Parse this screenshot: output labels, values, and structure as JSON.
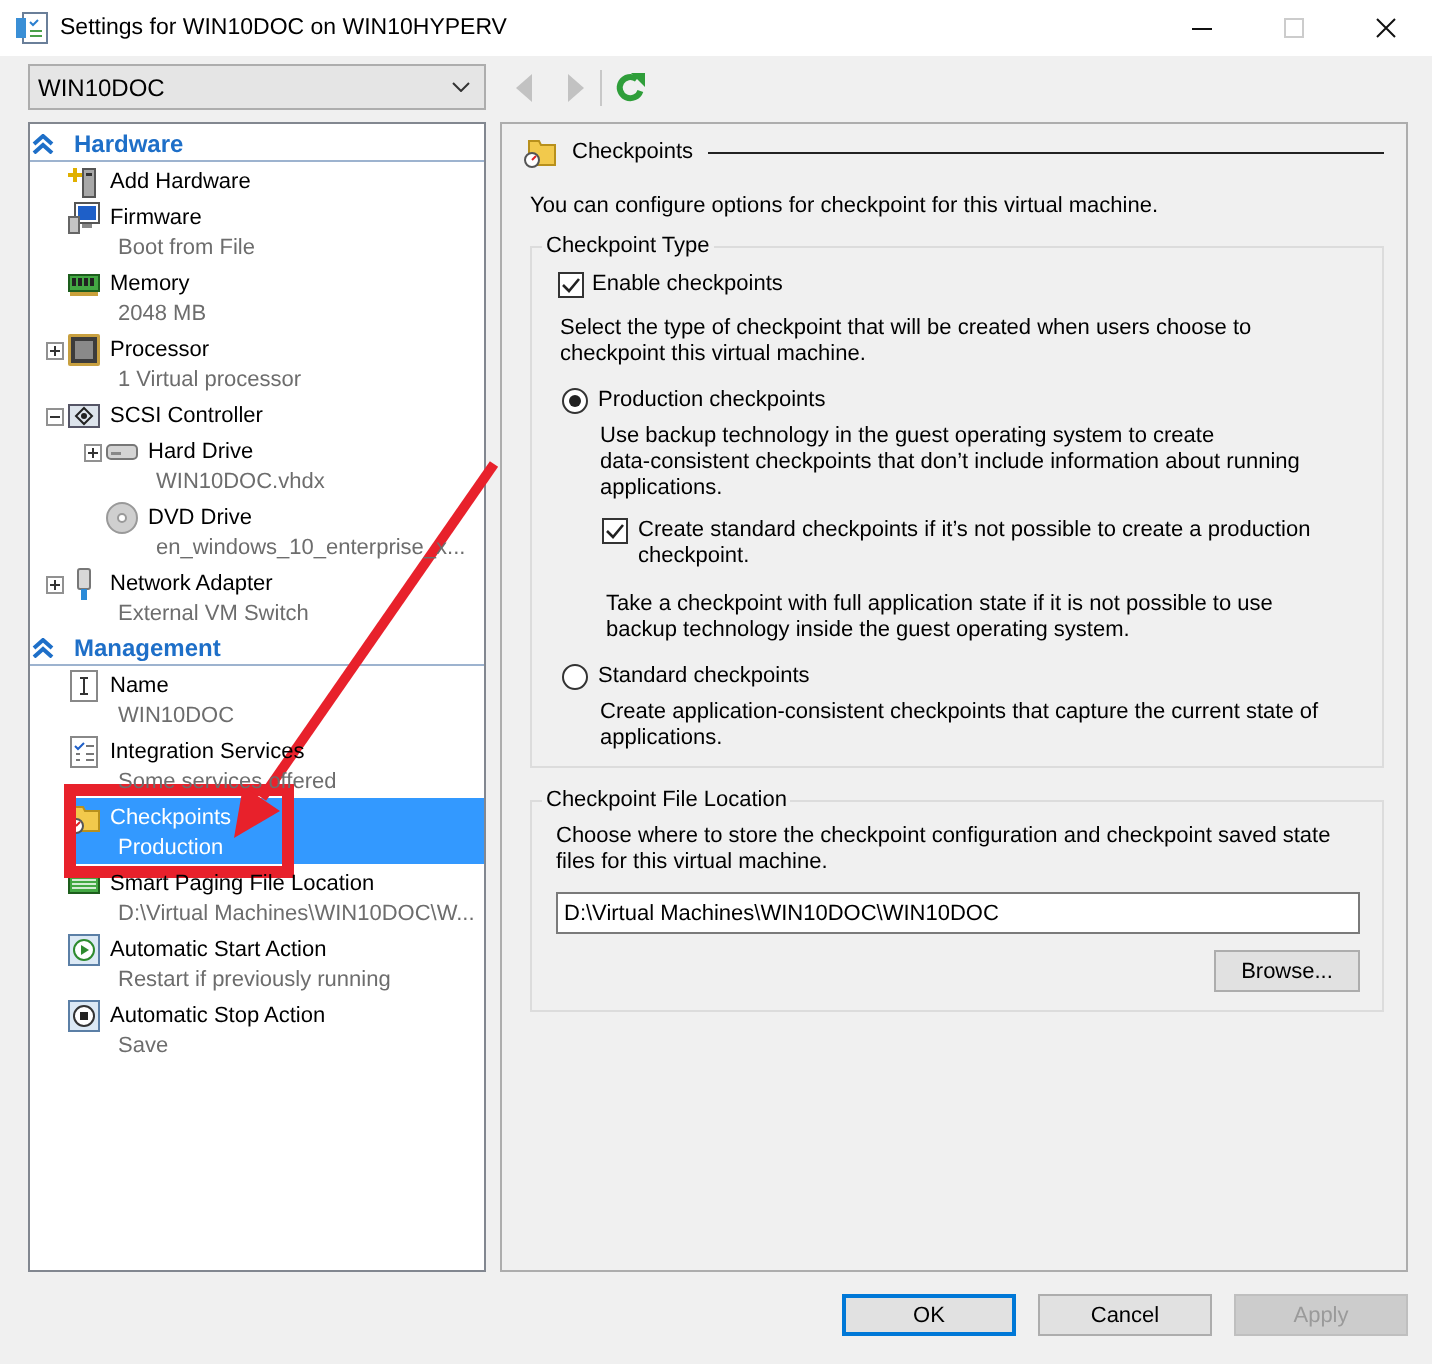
{
  "window": {
    "title": "Settings for WIN10DOC on WIN10HYPERV",
    "controls": [
      {
        "kind": "minimize",
        "disabled": false
      },
      {
        "kind": "maximize",
        "disabled": true
      },
      {
        "kind": "close",
        "disabled": false
      }
    ]
  },
  "toolbar": {
    "vm_selector": {
      "value": "WIN10DOC"
    },
    "buttons": [
      {
        "kind": "back",
        "disabled": true
      },
      {
        "kind": "forward",
        "disabled": true
      },
      {
        "kind": "refresh",
        "disabled": false
      }
    ]
  },
  "sidebar": {
    "sections": [
      {
        "title": "Hardware",
        "expanded": true,
        "items": [
          {
            "kind": "hardware",
            "label": "Add Hardware",
            "selected": false
          },
          {
            "kind": "firmware",
            "label": "Firmware",
            "detail": "Boot from File",
            "selected": false
          },
          {
            "kind": "memory",
            "label": "Memory",
            "detail": "2048 MB",
            "selected": false
          },
          {
            "kind": "processor",
            "label": "Processor",
            "detail": "1 Virtual processor",
            "expanded": false,
            "selected": false
          },
          {
            "kind": "controller",
            "label": "SCSI Controller",
            "expanded": true,
            "selected": false,
            "children": [
              {
                "kind": "disk",
                "label": "Hard Drive",
                "detail": "WIN10DOC.vhdx",
                "expanded": false,
                "selected": false
              },
              {
                "kind": "dvd",
                "label": "DVD Drive",
                "detail": "en_windows_10_enterprise_x...",
                "selected": false
              }
            ]
          },
          {
            "kind": "network",
            "label": "Network Adapter",
            "detail": "External VM Switch",
            "expanded": false,
            "selected": false
          }
        ]
      },
      {
        "title": "Management",
        "expanded": true,
        "items": [
          {
            "kind": "name",
            "label": "Name",
            "detail": "WIN10DOC",
            "selected": false
          },
          {
            "kind": "services",
            "label": "Integration Services",
            "detail": "Some services offered",
            "selected": false
          },
          {
            "kind": "checkpoints",
            "label": "Checkpoints",
            "detail": "Production",
            "selected": true
          },
          {
            "kind": "paging",
            "label": "Smart Paging File Location",
            "detail": "D:\\Virtual Machines\\WIN10DOC\\W...",
            "selected": false
          },
          {
            "kind": "start",
            "label": "Automatic Start Action",
            "detail": "Restart if previously running",
            "selected": false
          },
          {
            "kind": "stop",
            "label": "Automatic Stop Action",
            "detail": "Save",
            "selected": false
          }
        ]
      }
    ]
  },
  "panel": {
    "title": "Checkpoints",
    "intro": "You can configure options for checkpoint for this virtual machine.",
    "checkpoint_type": {
      "legend": "Checkpoint Type",
      "enable": {
        "label": "Enable checkpoints",
        "checked": true
      },
      "prompt": "Select the type of checkpoint that will be created when users choose to checkpoint this virtual machine.",
      "options": [
        {
          "label": "Production checkpoints",
          "selected": true,
          "description": "Use backup technology in the guest operating system to create data-consistent checkpoints that don’t include information about running applications.",
          "fallback": {
            "label": "Create standard checkpoints if it’s not possible to create a production checkpoint.",
            "checked": true
          },
          "note": "Take a checkpoint with full application state if it is not possible to use backup technology inside the guest operating system."
        },
        {
          "label": "Standard checkpoints",
          "selected": false,
          "description": "Create application-consistent checkpoints that capture the current state of applications."
        }
      ]
    },
    "file_location": {
      "legend": "Checkpoint File Location",
      "description": "Choose where to store the checkpoint configuration and checkpoint saved state files for this virtual machine.",
      "path": "D:\\Virtual Machines\\WIN10DOC\\WIN10DOC",
      "button": "Browse..."
    }
  },
  "footer": {
    "buttons": [
      {
        "label": "OK",
        "default": true,
        "disabled": false
      },
      {
        "label": "Cancel",
        "default": false,
        "disabled": false
      },
      {
        "label": "Apply",
        "default": false,
        "disabled": true
      }
    ]
  }
}
